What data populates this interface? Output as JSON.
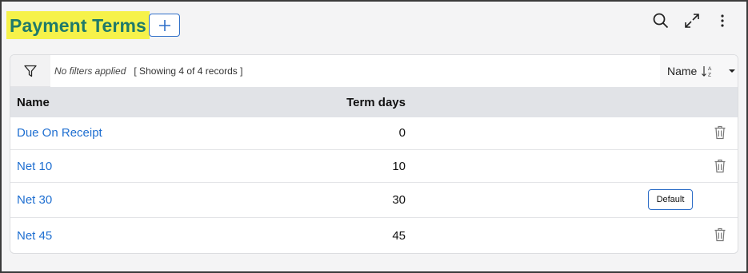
{
  "header": {
    "title": "Payment Terms",
    "add_icon": "plus-icon",
    "actions": [
      "search-icon",
      "expand-icon",
      "more-vertical-icon"
    ]
  },
  "filter_bar": {
    "filter_icon": "filter-icon",
    "status": "No filters applied",
    "records": "[ Showing 4 of 4 records ]",
    "sort_label": "Name",
    "sort_icon": "sort-az-icon",
    "dropdown_icon": "caret-down-icon"
  },
  "table": {
    "columns": [
      "Name",
      "Term days"
    ],
    "rows": [
      {
        "name": "Due On Receipt",
        "days": "0",
        "action": "delete"
      },
      {
        "name": "Net 10",
        "days": "10",
        "action": "delete"
      },
      {
        "name": "Net 30",
        "days": "30",
        "action": "default",
        "default_label": "Default"
      },
      {
        "name": "Net 45",
        "days": "45",
        "action": "delete"
      }
    ]
  },
  "colors": {
    "title_highlight": "#f6f24a",
    "title_text": "#1f7a6a",
    "link": "#1f6fd1",
    "accent_border": "#2f6fc8",
    "header_bg": "#e1e3e7"
  }
}
